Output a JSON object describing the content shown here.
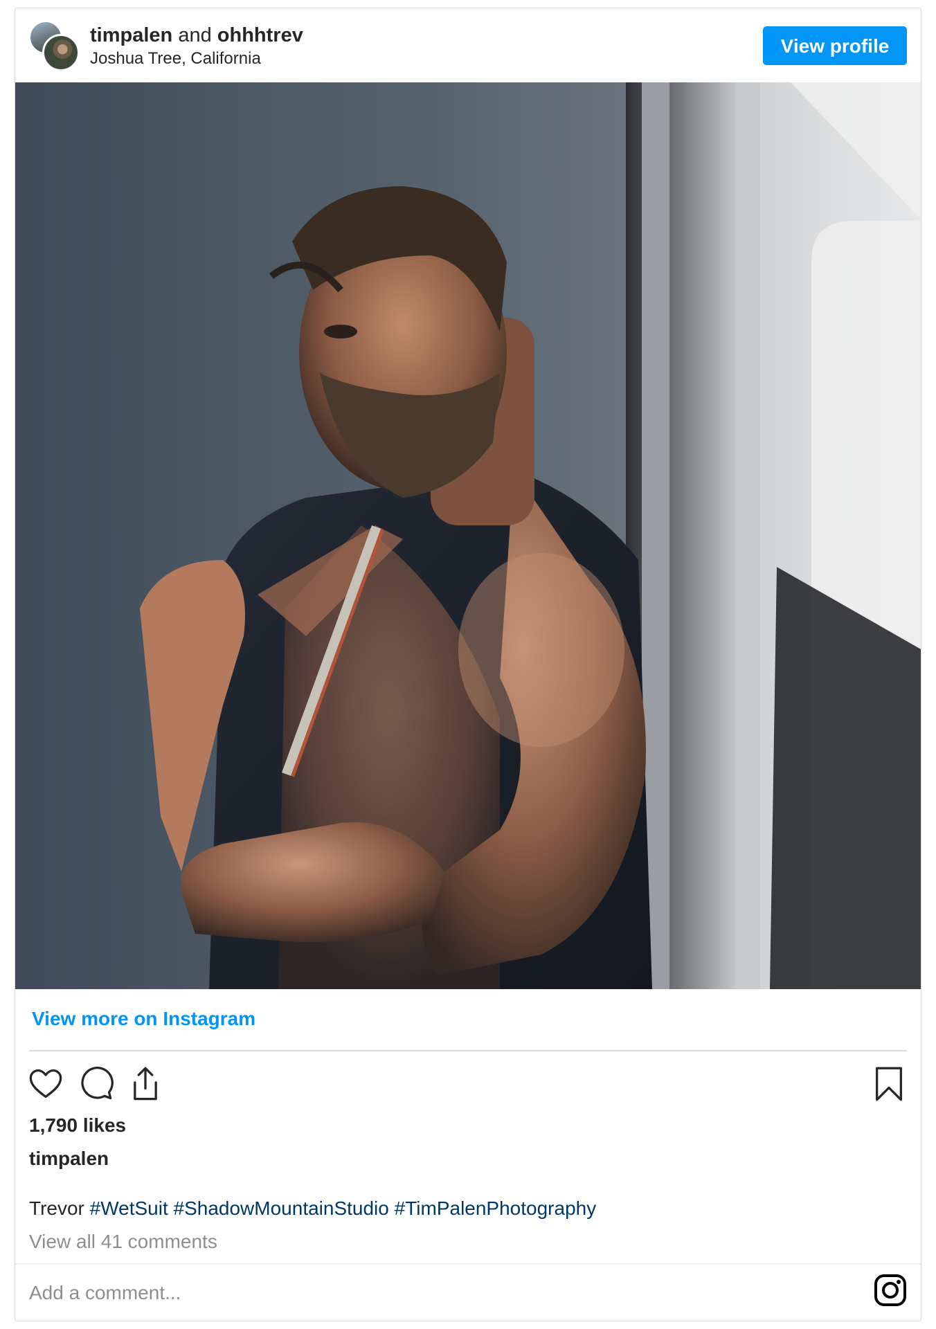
{
  "header": {
    "author_1": "timpalen",
    "connector": "and",
    "author_2": "ohhhtrev",
    "location": "Joshua Tree, California",
    "view_profile_label": "View profile"
  },
  "post": {
    "image_alt": "Man in a sleeveless wetsuit with a partially open zipper posing against a grey wall",
    "view_more_label": "View more on Instagram",
    "likes": "1,790 likes",
    "owner": "timpalen",
    "caption_text": "Trevor",
    "hashtags": [
      "#WetSuit",
      "#ShadowMountainStudio",
      "#TimPalenPhotography"
    ],
    "comments_link": "View all 41 comments"
  },
  "comment_box": {
    "placeholder": "Add a comment..."
  },
  "icons": {
    "like": "heart-icon",
    "comment": "comment-bubble-icon",
    "share": "share-icon",
    "save": "bookmark-icon",
    "brand": "instagram-logo-icon"
  },
  "colors": {
    "accent": "#0095f6",
    "hashtag": "#00376b",
    "muted": "#8e8e8e",
    "text": "#262626"
  }
}
